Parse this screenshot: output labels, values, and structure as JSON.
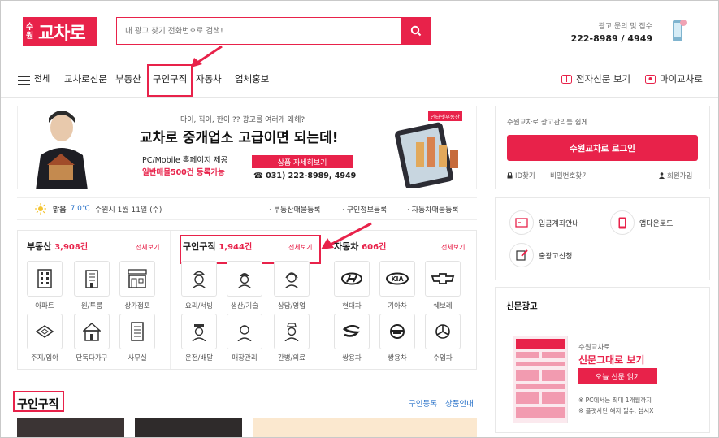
{
  "logo": {
    "small": "수원",
    "main": "교차로"
  },
  "search": {
    "placeholder": "내 광고 찾기 전화번호로 검색!"
  },
  "adinfo": {
    "label": "광고 문의 및 접수",
    "phone": "222-8989 / 4949"
  },
  "nav": {
    "menu_label": "전체",
    "items": [
      "교차로신문",
      "부동산",
      "구인구직",
      "자동차",
      "업체홍보"
    ],
    "right": [
      "전자신문 보기",
      "마이교차로"
    ]
  },
  "banner": {
    "tagline": "다이, 직이, 한이 ?? 광고를 여러개 왜해?",
    "badge": "인터넷부동산",
    "headline": "교차로 중개업소 고급이면 되는데!",
    "line1": "PC/Mobile 홈페이지 제공",
    "line2": "일반매물500건 등록가능",
    "cta": "상품 자세히보기",
    "phone": "☎ 031) 222-8989, 4949"
  },
  "login": {
    "prompt": "수원교차로 광고관리를 쉽게",
    "button": "수원교차로 로그인",
    "find_id": "ID찾기",
    "find_pw": "비밀번호찾기",
    "join": "회원가입"
  },
  "weather": {
    "status": "맑음",
    "temp": "7.0℃",
    "date": "수원시 1월 11일 (수)",
    "links": [
      "부동산매물등록",
      "구인정보등록",
      "자동차매물등록"
    ]
  },
  "categories": [
    {
      "title": "부동산",
      "count": "3,908건",
      "more": "전체보기",
      "items": [
        "아파트",
        "원/투룸",
        "상가점포",
        "주지/임야",
        "단독다가구",
        "사무실"
      ]
    },
    {
      "title": "구인구직",
      "count": "1,944건",
      "more": "전체보기",
      "items": [
        "요리/서빙",
        "생산/기술",
        "상담/영업",
        "운전/배달",
        "매장관리",
        "간병/의료"
      ]
    },
    {
      "title": "자동차",
      "count": "606건",
      "more": "전체보기",
      "items": [
        "현대차",
        "기아차",
        "쉐보레",
        "쌍용차",
        "쌍용차",
        "수입차"
      ]
    }
  ],
  "services": [
    "입금계좌안내",
    "앱다운로드",
    "출광고신청"
  ],
  "newspaper": {
    "section": "신문광고",
    "brand": "수원교차로",
    "title": "신문그대로 보기",
    "button": "오늘 신문 읽기",
    "note1": "※ PC에서는 최대 1개월까지",
    "note2": "※ 플랫사단 해지 필수, 섬시X"
  },
  "jobs_section": {
    "title": "구인구직",
    "links": [
      "구인등록",
      "상품안내"
    ]
  },
  "colors": {
    "accent": "#e8224a",
    "link": "#2a73c9"
  }
}
